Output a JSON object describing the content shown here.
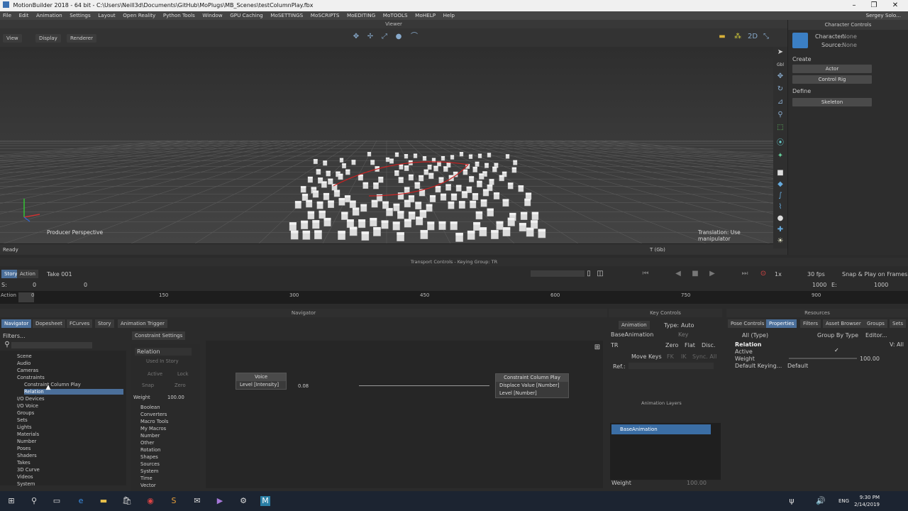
{
  "window": {
    "title": "MotionBuilder 2018 - 64 bit - C:\\Users\\Neill3d\\Documents\\GitHub\\MoPlugs\\MB_Scenes\\testColumnPlay.fbx",
    "user": "Sergey Solo..."
  },
  "menu": [
    "File",
    "Edit",
    "Animation",
    "Settings",
    "Layout",
    "Open Reality",
    "Python Tools",
    "Window",
    "GPU Caching",
    "MoSETTINGS",
    "MoSCRIPTS",
    "MoEDITING",
    "MoTOOLS",
    "MoHELP",
    "Help"
  ],
  "viewer": {
    "title": "Viewer",
    "buttons": [
      "View",
      "Display",
      "Renderer"
    ],
    "camera_label": "Producer Perspective",
    "hint": "Translation: Use manipulator",
    "status": "Ready",
    "t_label": "T (Gb)"
  },
  "character_controls": {
    "title": "Character Controls",
    "character_label": "Character:",
    "character_value": "None",
    "source_label": "Source:",
    "source_value": "None",
    "create_label": "Create",
    "define_label": "Define",
    "actor": "Actor",
    "control_rig": "Control Rig",
    "skeleton": "Skeleton"
  },
  "transport": {
    "title": "Transport Controls  -  Keying Group: TR",
    "story_tab": "Story",
    "action_tab": "Action",
    "take": "Take 001",
    "speed": "1x",
    "fps": "30 fps",
    "snap": "Snap & Play on Frames",
    "s_label": "S:",
    "s_value": "0",
    "start": "0",
    "e_value": "1000",
    "e_label": "E:",
    "end": "1000",
    "action_label": "Action",
    "ticks": [
      "0",
      "150",
      "300",
      "450",
      "600",
      "750",
      "900"
    ]
  },
  "navigator": {
    "title": "Navigator",
    "tabs": [
      "Navigator",
      "Dopesheet",
      "FCurves",
      "Story",
      "Animation Trigger"
    ],
    "filters": "Filters...",
    "tree": [
      "Scene",
      "Audio",
      "Cameras",
      "Constraints",
      "Constraint Column Play",
      "Relation",
      "I/O Devices",
      "I/O Voice",
      "Groups",
      "Sets",
      "Lights",
      "Materials",
      "Number",
      "Poses",
      "Shaders",
      "Takes",
      "3D Curve",
      "Videos",
      "System"
    ]
  },
  "constraint_settings": {
    "tab": "Constraint Settings",
    "name": "Relation",
    "used_in_story": "Used In Story",
    "active": "Active",
    "lock": "Lock",
    "snap": "Snap",
    "zero": "Zero",
    "weight_label": "Weight",
    "weight_value": "100.00",
    "categories": [
      "Boolean",
      "Converters",
      "Macro Tools",
      "My Macros",
      "Number",
      "Other",
      "Rotation",
      "Shapes",
      "Sources",
      "System",
      "Time",
      "Vector"
    ]
  },
  "graph": {
    "voice_node": {
      "title": "Voice",
      "output": "Level [Intensity]",
      "value": "0.08"
    },
    "target_node": {
      "title": "Constraint Column Play",
      "in1": "Displace Value [Number]",
      "in2": "Level [Number]"
    }
  },
  "key_controls": {
    "title": "Key Controls",
    "animation": "Animation",
    "type_label": "Type:",
    "type_value": "Auto",
    "base": "BaseAnimation",
    "key": "Key",
    "tr": "TR",
    "zero": "Zero",
    "flat": "Flat",
    "disc": "Disc.",
    "move_keys": "Move Keys",
    "fk": "FK",
    "ik": "IK",
    "sync": "Sync. All",
    "ref": "Ref.:",
    "layers_title": "Animation Layers",
    "layer": "BaseAnimation",
    "weight": "Weight",
    "weight_value": "100.00"
  },
  "resources": {
    "title": "Resources",
    "tabs": [
      "Pose Controls",
      "Properties",
      "Filters",
      "Asset Browser",
      "Groups",
      "Sets"
    ],
    "all_type": "All (Type)",
    "group_by": "Group By Type",
    "editor": "Editor...",
    "section": "Relation",
    "v_all": "V: All",
    "props": [
      "Active",
      "Weight",
      "Default Keying..."
    ],
    "weight_value": "100.00",
    "default_value": "Default"
  },
  "taskbar": {
    "time": "9:30 PM",
    "date": "2/14/2019",
    "lang": "ENG"
  }
}
